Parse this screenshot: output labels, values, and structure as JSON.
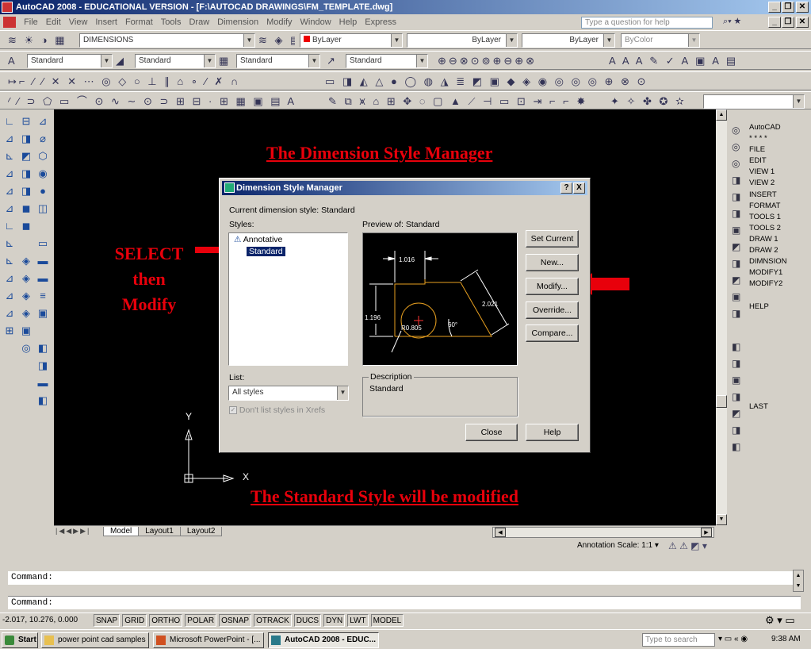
{
  "window": {
    "title": "AutoCAD 2008 - EDUCATIONAL VERSION - [F:\\AUTOCAD DRAWINGS\\FM_TEMPLATE.dwg]",
    "help_placeholder": "Type a question for help"
  },
  "menu": [
    "File",
    "Edit",
    "View",
    "Insert",
    "Format",
    "Tools",
    "Draw",
    "Dimension",
    "Modify",
    "Window",
    "Help",
    "Express"
  ],
  "toolbars": {
    "layer": "DIMENSIONS",
    "color": "ByLayer",
    "linetype": "ByLayer",
    "lineweight": "ByLayer",
    "plotstyle": "ByColor",
    "textstyle": "Standard",
    "dimstyle": "Standard",
    "tablestyle": "Standard",
    "mleaderstyle": "Standard"
  },
  "slide": {
    "title": "The Dimension Style Manager",
    "select_label": "SELECT then Modify",
    "bottom_note": "The Standard Style will be modified"
  },
  "dialog": {
    "title": "Dimension Style Manager",
    "help": "?",
    "close_x": "X",
    "current_style": "Current dimension style: Standard",
    "styles_label": "Styles:",
    "styles": [
      "Annotative",
      "Standard"
    ],
    "preview_label": "Preview of: Standard",
    "preview_dims": {
      "top": "1.016",
      "left": "1.196",
      "diag": "2.021",
      "radius": "R0.805",
      "angle": "60°"
    },
    "buttons": {
      "set_current": "Set Current",
      "new": "New...",
      "modify": "Modify...",
      "override": "Override...",
      "compare": "Compare...",
      "close": "Close",
      "help": "Help"
    },
    "list_label": "List:",
    "list_value": "All styles",
    "xref_checkbox": "Don't list styles in Xrefs",
    "description_label": "Description",
    "description_text": "Standard"
  },
  "axis": {
    "y": "Y",
    "x": "X"
  },
  "tabs": [
    "Model",
    "Layout1",
    "Layout2"
  ],
  "annotation_scale": "Annotation Scale:  1:1 ▾",
  "right_menu": [
    "AutoCAD",
    "* * * *",
    "FILE",
    "EDIT",
    "VIEW 1",
    "VIEW 2",
    "INSERT",
    "FORMAT",
    "TOOLS 1",
    "TOOLS 2",
    "DRAW 1",
    "DRAW 2",
    "DIMNSION",
    "MODIFY1",
    "MODIFY2",
    "",
    "HELP",
    "",
    "",
    "",
    "",
    "",
    "",
    "",
    "",
    "LAST"
  ],
  "command_lines": [
    "Command:",
    "Command:"
  ],
  "status": {
    "coords": "-2.017, 10.276, 0.000",
    "toggles": [
      "SNAP",
      "GRID",
      "ORTHO",
      "POLAR",
      "OSNAP",
      "OTRACK",
      "DUCS",
      "DYN",
      "LWT",
      "MODEL"
    ]
  },
  "taskbar": {
    "start": "Start",
    "tasks": [
      "power point cad samples",
      "Microsoft PowerPoint - [...",
      "AutoCAD 2008 - EDUC..."
    ],
    "search_placeholder": "Type to search",
    "clock": "9:38 AM"
  }
}
